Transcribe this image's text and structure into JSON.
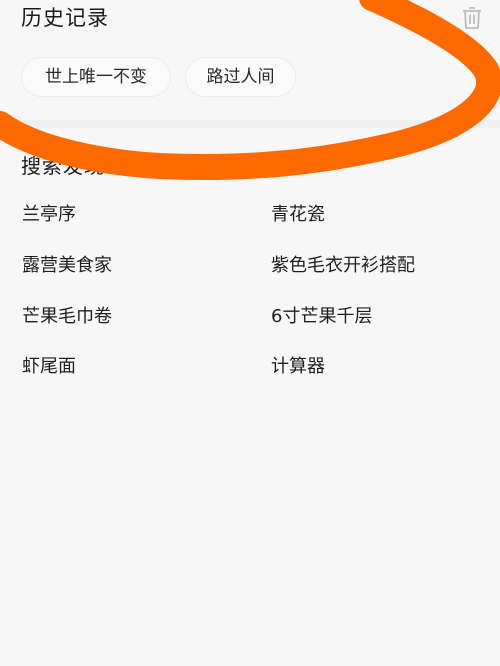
{
  "history": {
    "title": "历史记录",
    "delete_icon": "trash-icon",
    "chips": [
      "世上唯一不变",
      "路过人间"
    ]
  },
  "discover": {
    "title": "搜索发现",
    "items": [
      "兰亭序",
      "青花瓷",
      "露营美食家",
      "紫色毛衣开衫搭配",
      "芒果毛巾卷",
      "6寸芒果千层",
      "虾尾面",
      "计算器"
    ]
  },
  "annotation": {
    "color": "#ff6a00",
    "shape": "hand-drawn-circle"
  }
}
